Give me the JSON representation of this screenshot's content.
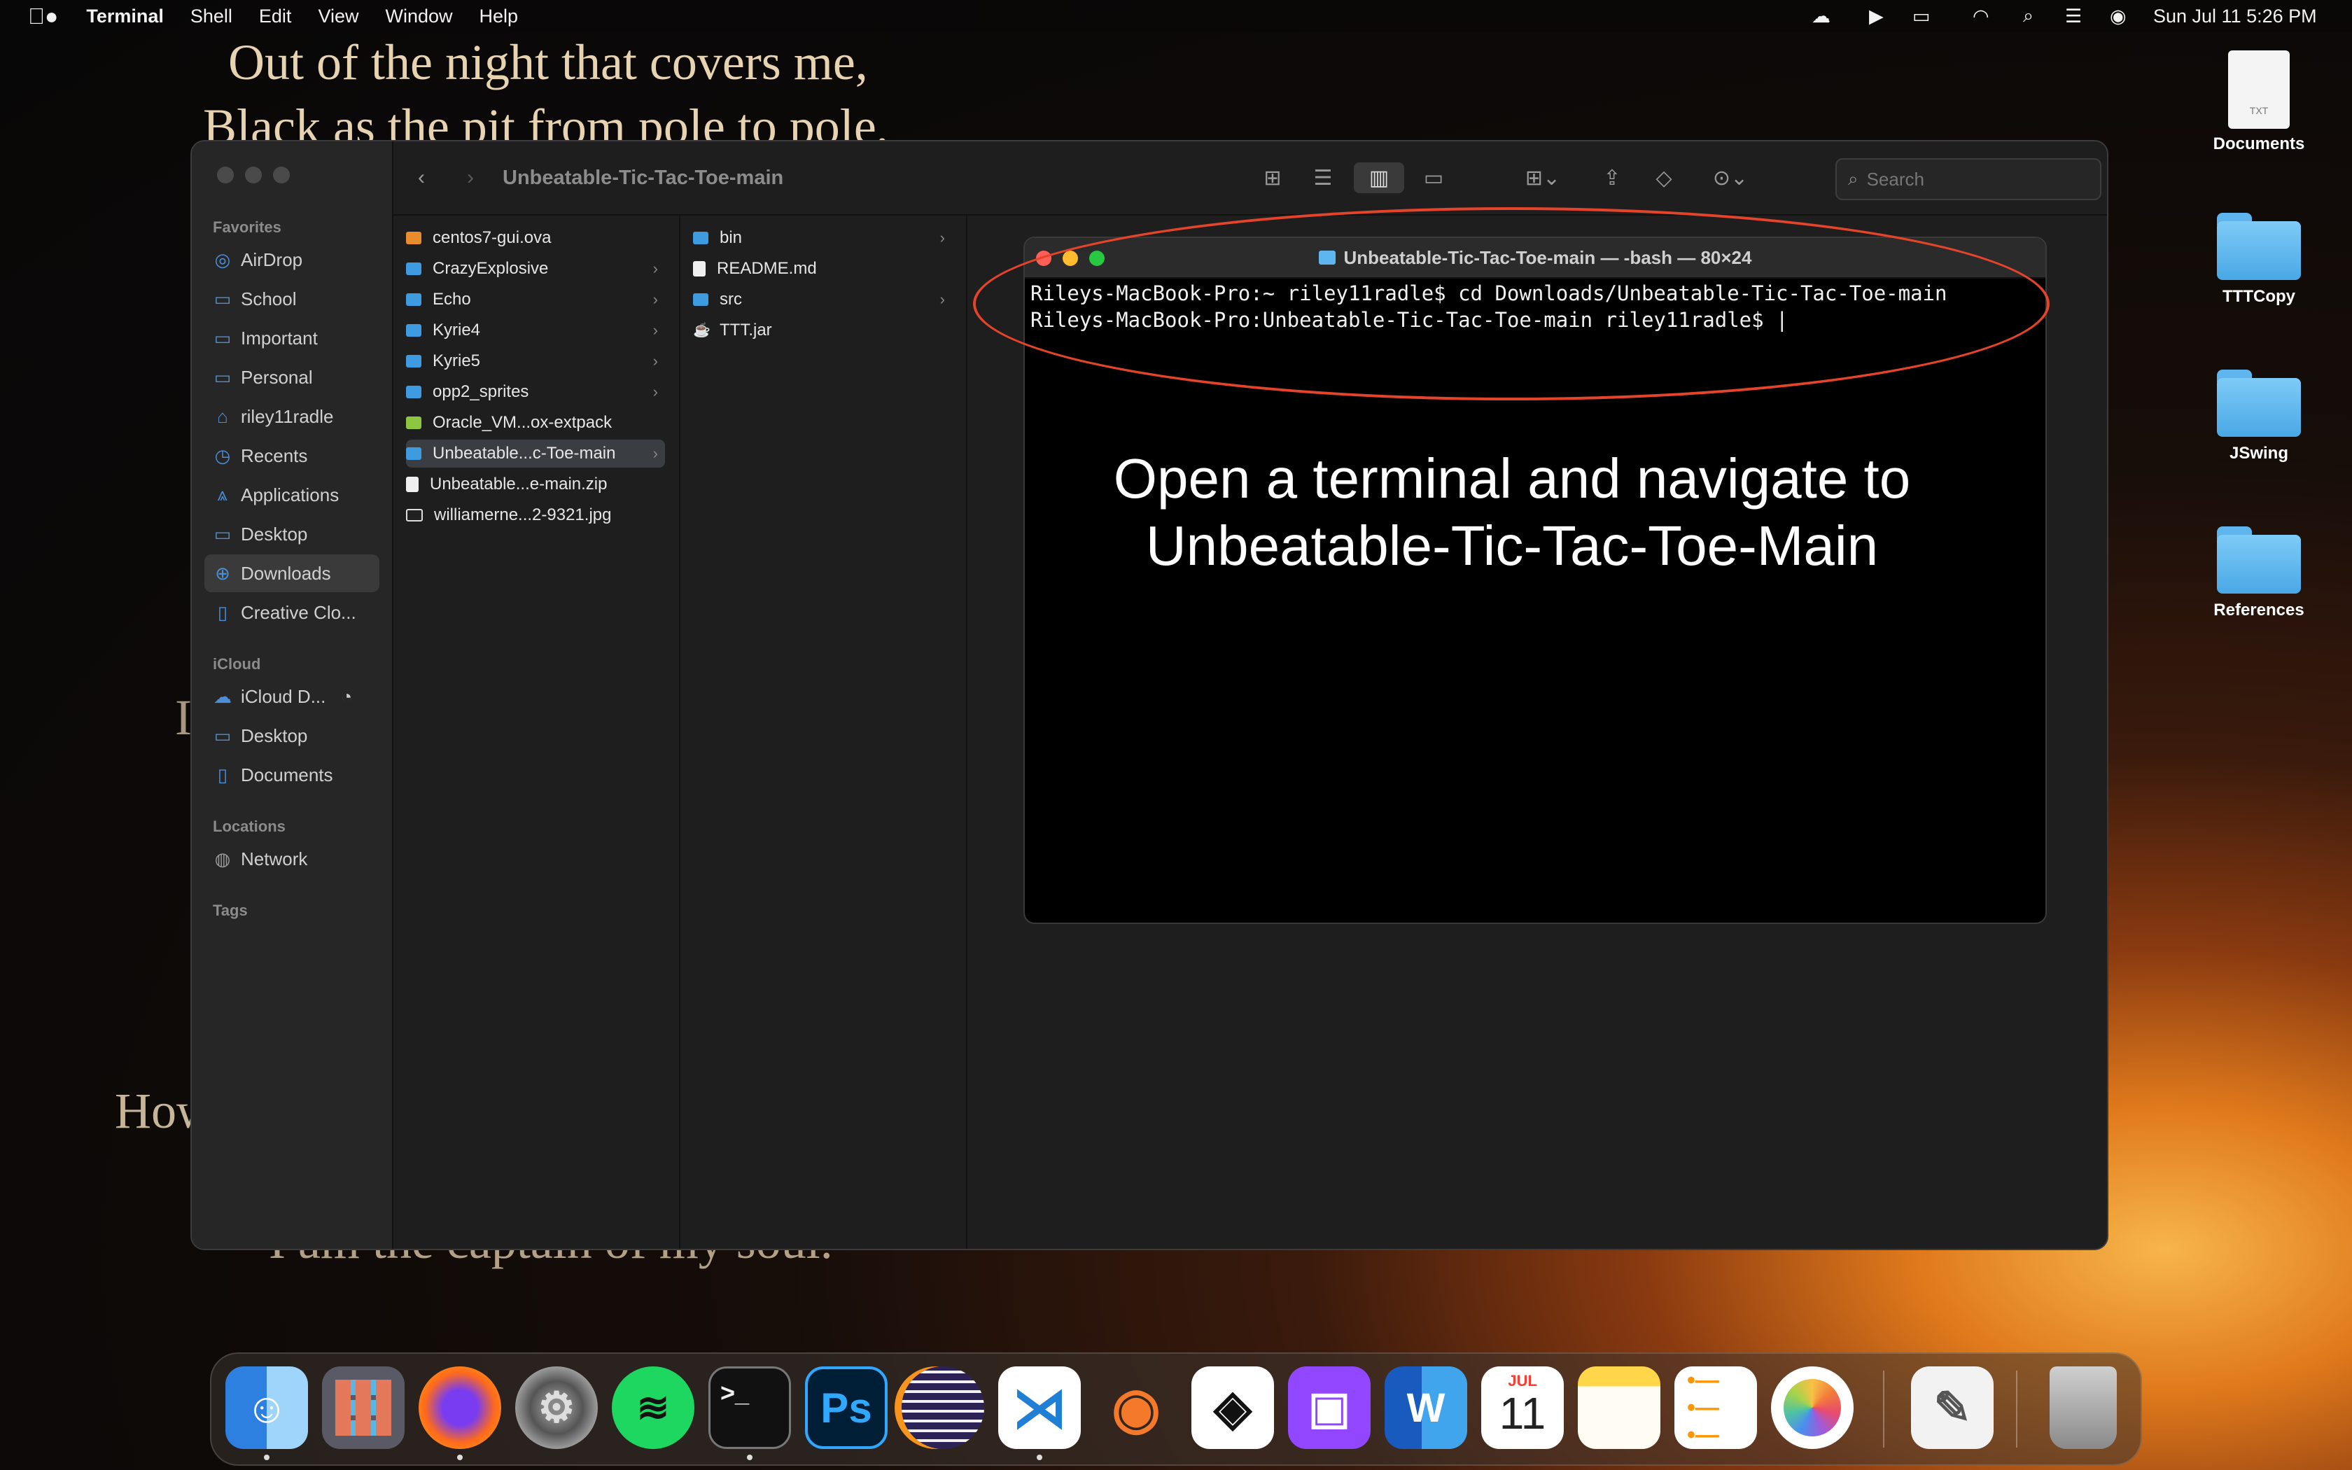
{
  "menubar": {
    "apple": "",
    "app": "Terminal",
    "items": [
      "Shell",
      "Edit",
      "View",
      "Window",
      "Help"
    ],
    "clock": "Sun Jul 11  5:26 PM"
  },
  "wallpaper": {
    "line1": "Out of the night that covers me,",
    "line2": "Black as the pit from pole to pole,",
    "frag1": "I",
    "frag2": "How",
    "line3": "I am the captain of my soul."
  },
  "desktop": [
    {
      "label": "Documents",
      "kind": "txt",
      "badge": "TXT"
    },
    {
      "label": "TTTCopy",
      "kind": "folder"
    },
    {
      "label": "JSwing",
      "kind": "folder"
    },
    {
      "label": "References",
      "kind": "folder"
    }
  ],
  "finder": {
    "title": "Unbeatable-Tic-Tac-Toe-main",
    "search_placeholder": "Search",
    "sections": {
      "favorites": "Favorites",
      "icloud": "iCloud",
      "locations": "Locations",
      "tags": "Tags"
    },
    "favorites": [
      "AirDrop",
      "School",
      "Important",
      "Personal",
      "riley11radle",
      "Recents",
      "Applications",
      "Desktop",
      "Downloads",
      "Creative Clo..."
    ],
    "icloud": [
      "iCloud D...",
      "Desktop",
      "Documents"
    ],
    "locations": [
      "Network"
    ],
    "column1": [
      "centos7-gui.ova",
      "CrazyExplosive",
      "Echo",
      "Kyrie4",
      "Kyrie5",
      "opp2_sprites",
      "Oracle_VM...ox-extpack",
      "Unbeatable...c-Toe-main",
      "Unbeatable...e-main.zip",
      "williamerne...2-9321.jpg"
    ],
    "column2": [
      "bin",
      "README.md",
      "src",
      "TTT.jar"
    ]
  },
  "terminal": {
    "title": "Unbeatable-Tic-Tac-Toe-main — -bash — 80×24",
    "line1": "Rileys-MacBook-Pro:~ riley11radle$ cd Downloads/Unbeatable-Tic-Tac-Toe-main",
    "line2": "Rileys-MacBook-Pro:Unbeatable-Tic-Tac-Toe-main riley11radle$ |"
  },
  "caption": {
    "line1": "Open a terminal and navigate to",
    "line2": "Unbeatable-Tic-Tac-Toe-Main"
  },
  "dock": {
    "ps_label": "Ps",
    "word_label": "W",
    "calendar_month": "JUL",
    "calendar_day": "11"
  },
  "colors": {
    "annotation": "#e4442a",
    "folder": "#5fb6ef",
    "accent": "#3e9be0"
  }
}
